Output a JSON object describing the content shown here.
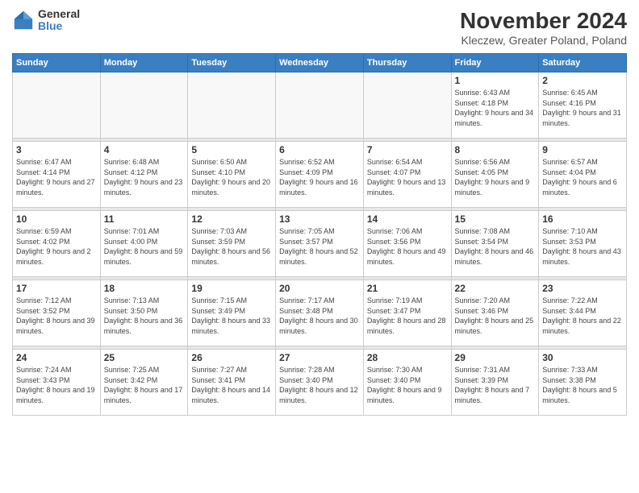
{
  "logo": {
    "general": "General",
    "blue": "Blue"
  },
  "title": "November 2024",
  "location": "Kleczew, Greater Poland, Poland",
  "weekdays": [
    "Sunday",
    "Monday",
    "Tuesday",
    "Wednesday",
    "Thursday",
    "Friday",
    "Saturday"
  ],
  "weeks": [
    [
      {
        "day": "",
        "info": ""
      },
      {
        "day": "",
        "info": ""
      },
      {
        "day": "",
        "info": ""
      },
      {
        "day": "",
        "info": ""
      },
      {
        "day": "",
        "info": ""
      },
      {
        "day": "1",
        "info": "Sunrise: 6:43 AM\nSunset: 4:18 PM\nDaylight: 9 hours and 34 minutes."
      },
      {
        "day": "2",
        "info": "Sunrise: 6:45 AM\nSunset: 4:16 PM\nDaylight: 9 hours and 31 minutes."
      }
    ],
    [
      {
        "day": "3",
        "info": "Sunrise: 6:47 AM\nSunset: 4:14 PM\nDaylight: 9 hours and 27 minutes."
      },
      {
        "day": "4",
        "info": "Sunrise: 6:48 AM\nSunset: 4:12 PM\nDaylight: 9 hours and 23 minutes."
      },
      {
        "day": "5",
        "info": "Sunrise: 6:50 AM\nSunset: 4:10 PM\nDaylight: 9 hours and 20 minutes."
      },
      {
        "day": "6",
        "info": "Sunrise: 6:52 AM\nSunset: 4:09 PM\nDaylight: 9 hours and 16 minutes."
      },
      {
        "day": "7",
        "info": "Sunrise: 6:54 AM\nSunset: 4:07 PM\nDaylight: 9 hours and 13 minutes."
      },
      {
        "day": "8",
        "info": "Sunrise: 6:56 AM\nSunset: 4:05 PM\nDaylight: 9 hours and 9 minutes."
      },
      {
        "day": "9",
        "info": "Sunrise: 6:57 AM\nSunset: 4:04 PM\nDaylight: 9 hours and 6 minutes."
      }
    ],
    [
      {
        "day": "10",
        "info": "Sunrise: 6:59 AM\nSunset: 4:02 PM\nDaylight: 9 hours and 2 minutes."
      },
      {
        "day": "11",
        "info": "Sunrise: 7:01 AM\nSunset: 4:00 PM\nDaylight: 8 hours and 59 minutes."
      },
      {
        "day": "12",
        "info": "Sunrise: 7:03 AM\nSunset: 3:59 PM\nDaylight: 8 hours and 56 minutes."
      },
      {
        "day": "13",
        "info": "Sunrise: 7:05 AM\nSunset: 3:57 PM\nDaylight: 8 hours and 52 minutes."
      },
      {
        "day": "14",
        "info": "Sunrise: 7:06 AM\nSunset: 3:56 PM\nDaylight: 8 hours and 49 minutes."
      },
      {
        "day": "15",
        "info": "Sunrise: 7:08 AM\nSunset: 3:54 PM\nDaylight: 8 hours and 46 minutes."
      },
      {
        "day": "16",
        "info": "Sunrise: 7:10 AM\nSunset: 3:53 PM\nDaylight: 8 hours and 43 minutes."
      }
    ],
    [
      {
        "day": "17",
        "info": "Sunrise: 7:12 AM\nSunset: 3:52 PM\nDaylight: 8 hours and 39 minutes."
      },
      {
        "day": "18",
        "info": "Sunrise: 7:13 AM\nSunset: 3:50 PM\nDaylight: 8 hours and 36 minutes."
      },
      {
        "day": "19",
        "info": "Sunrise: 7:15 AM\nSunset: 3:49 PM\nDaylight: 8 hours and 33 minutes."
      },
      {
        "day": "20",
        "info": "Sunrise: 7:17 AM\nSunset: 3:48 PM\nDaylight: 8 hours and 30 minutes."
      },
      {
        "day": "21",
        "info": "Sunrise: 7:19 AM\nSunset: 3:47 PM\nDaylight: 8 hours and 28 minutes."
      },
      {
        "day": "22",
        "info": "Sunrise: 7:20 AM\nSunset: 3:46 PM\nDaylight: 8 hours and 25 minutes."
      },
      {
        "day": "23",
        "info": "Sunrise: 7:22 AM\nSunset: 3:44 PM\nDaylight: 8 hours and 22 minutes."
      }
    ],
    [
      {
        "day": "24",
        "info": "Sunrise: 7:24 AM\nSunset: 3:43 PM\nDaylight: 8 hours and 19 minutes."
      },
      {
        "day": "25",
        "info": "Sunrise: 7:25 AM\nSunset: 3:42 PM\nDaylight: 8 hours and 17 minutes."
      },
      {
        "day": "26",
        "info": "Sunrise: 7:27 AM\nSunset: 3:41 PM\nDaylight: 8 hours and 14 minutes."
      },
      {
        "day": "27",
        "info": "Sunrise: 7:28 AM\nSunset: 3:40 PM\nDaylight: 8 hours and 12 minutes."
      },
      {
        "day": "28",
        "info": "Sunrise: 7:30 AM\nSunset: 3:40 PM\nDaylight: 8 hours and 9 minutes."
      },
      {
        "day": "29",
        "info": "Sunrise: 7:31 AM\nSunset: 3:39 PM\nDaylight: 8 hours and 7 minutes."
      },
      {
        "day": "30",
        "info": "Sunrise: 7:33 AM\nSunset: 3:38 PM\nDaylight: 8 hours and 5 minutes."
      }
    ]
  ]
}
